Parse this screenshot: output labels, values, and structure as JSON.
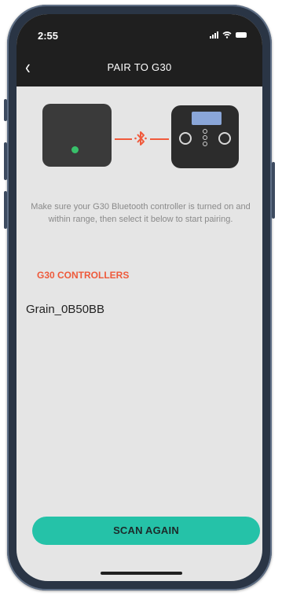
{
  "status_bar": {
    "time": "2:55"
  },
  "header": {
    "title": "PAIR TO G30",
    "back_icon": "chevron-left-icon"
  },
  "illustration": {
    "left_device": "hub-device-icon",
    "right_device": "g30-controller-icon",
    "link_icon": "bluetooth-icon",
    "accent_color": "#f05a3c",
    "led_color": "#38c06a"
  },
  "main": {
    "instructions": "Make sure your G30 Bluetooth controller is turned on and within range, then select it below to start pairing.",
    "section_title": "G30 CONTROLLERS",
    "controllers": [
      {
        "name": "Grain_0B50BB"
      }
    ]
  },
  "footer": {
    "scan_label": "SCAN AGAIN",
    "button_color": "#25c2a8"
  }
}
